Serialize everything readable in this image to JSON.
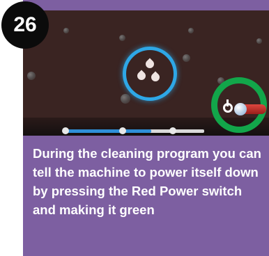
{
  "step": {
    "number": "26"
  },
  "screen": {
    "progress": 0.62,
    "power_switch_state": "red"
  },
  "caption": {
    "text": "During the cleaning program you can tell the machine to power itself down by pressing the Red Power switch and making it green"
  },
  "colors": {
    "card_background": "#7d5fa1",
    "screen_background": "#3a2422",
    "highlight_blue": "#2ea7e6",
    "highlight_green": "#12a64a",
    "switch_red": "#e0463f"
  },
  "icons": [
    "water-drops-icon",
    "power-icon"
  ]
}
